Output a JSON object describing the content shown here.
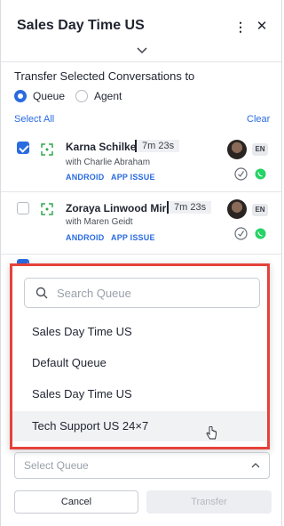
{
  "header": {
    "title": "Sales Day Time US"
  },
  "transfer": {
    "label": "Transfer Selected Conversations to",
    "options": [
      {
        "label": "Queue",
        "checked": true
      },
      {
        "label": "Agent",
        "checked": false
      }
    ],
    "select_all": "Select All",
    "clear": "Clear"
  },
  "conversations": [
    {
      "name": "Karna Schilke",
      "time": "7m 23s",
      "with": "with Charlie Abraham",
      "tags": [
        "ANDROID",
        "APP ISSUE"
      ],
      "lang": "EN",
      "checked": true
    },
    {
      "name": "Zoraya Linwood Mire",
      "time": "7m 23s",
      "with": "with Maren Geidt",
      "tags": [
        "ANDROID",
        "APP ISSUE"
      ],
      "lang": "EN",
      "checked": false
    }
  ],
  "dropdown": {
    "search_placeholder": "Search Queue",
    "options": [
      "Sales Day Time US",
      "Default Queue",
      "Sales Day Time US",
      "Tech Support US 24×7"
    ]
  },
  "queue_select": {
    "placeholder": "Select Queue"
  },
  "buttons": {
    "cancel": "Cancel",
    "transfer": "Transfer"
  },
  "colors": {
    "accent": "#2a6be0",
    "highlight_border": "#e5423a",
    "whatsapp": "#25d366",
    "channel_icon": "#2fa84f"
  }
}
